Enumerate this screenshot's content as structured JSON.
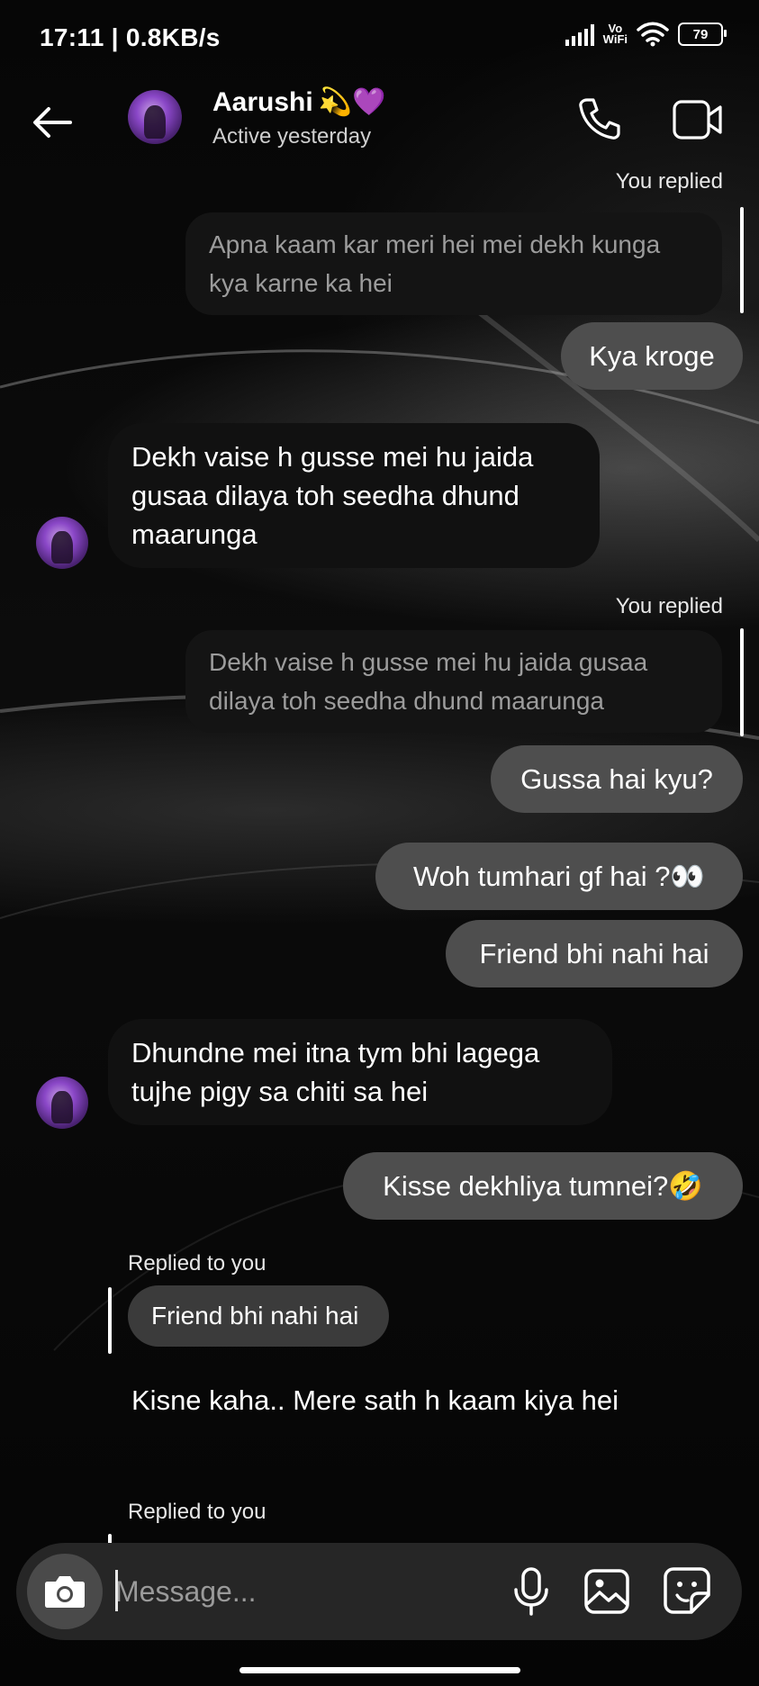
{
  "status_bar": {
    "time_speed": "17:11 | 0.8KB/s",
    "vowifi_top": "Vo",
    "vowifi_bottom": "WiFi",
    "battery": "79"
  },
  "header": {
    "name": "Aarushi",
    "name_emojis": "💫💜",
    "status": "Active yesterday",
    "icons": [
      "back-arrow-icon",
      "phone-call-icon",
      "video-call-icon"
    ]
  },
  "thread": {
    "reply_label_1": "You replied",
    "quote_1": "Apna kaam kar meri hei mei dekh kunga kya karne ka hei",
    "msg_1": "Kya kroge",
    "msg_2": "Dekh vaise h gusse mei hu jaida gusaa dilaya toh seedha dhund maarunga",
    "reply_label_2": "You replied",
    "quote_2": "Dekh vaise h gusse mei hu jaida gusaa dilaya toh seedha dhund maarunga",
    "msg_3": "Gussa hai kyu?",
    "msg_4": "Woh tumhari gf hai ?👀",
    "msg_5": "Friend bhi nahi hai",
    "msg_6": "Dhundne mei itna tym bhi lagega tujhe pigy sa chiti sa hei",
    "msg_7": "Kisse dekhliya tumnei?🤣",
    "replied_to_you_1": "Replied to you",
    "quote_3": "Friend bhi nahi hai",
    "msg_8": "Kisne kaha.. Mere sath h kaam kiya hei",
    "replied_to_you_2": "Replied to you"
  },
  "composer": {
    "placeholder": "Message...",
    "icons": [
      "camera-icon",
      "microphone-icon",
      "gallery-icon",
      "sticker-icon"
    ]
  },
  "colors": {
    "sent_bubble": "#4e4e4e",
    "received_bubble": "#111111",
    "composer_bg": "#262626",
    "background": "#050505"
  }
}
